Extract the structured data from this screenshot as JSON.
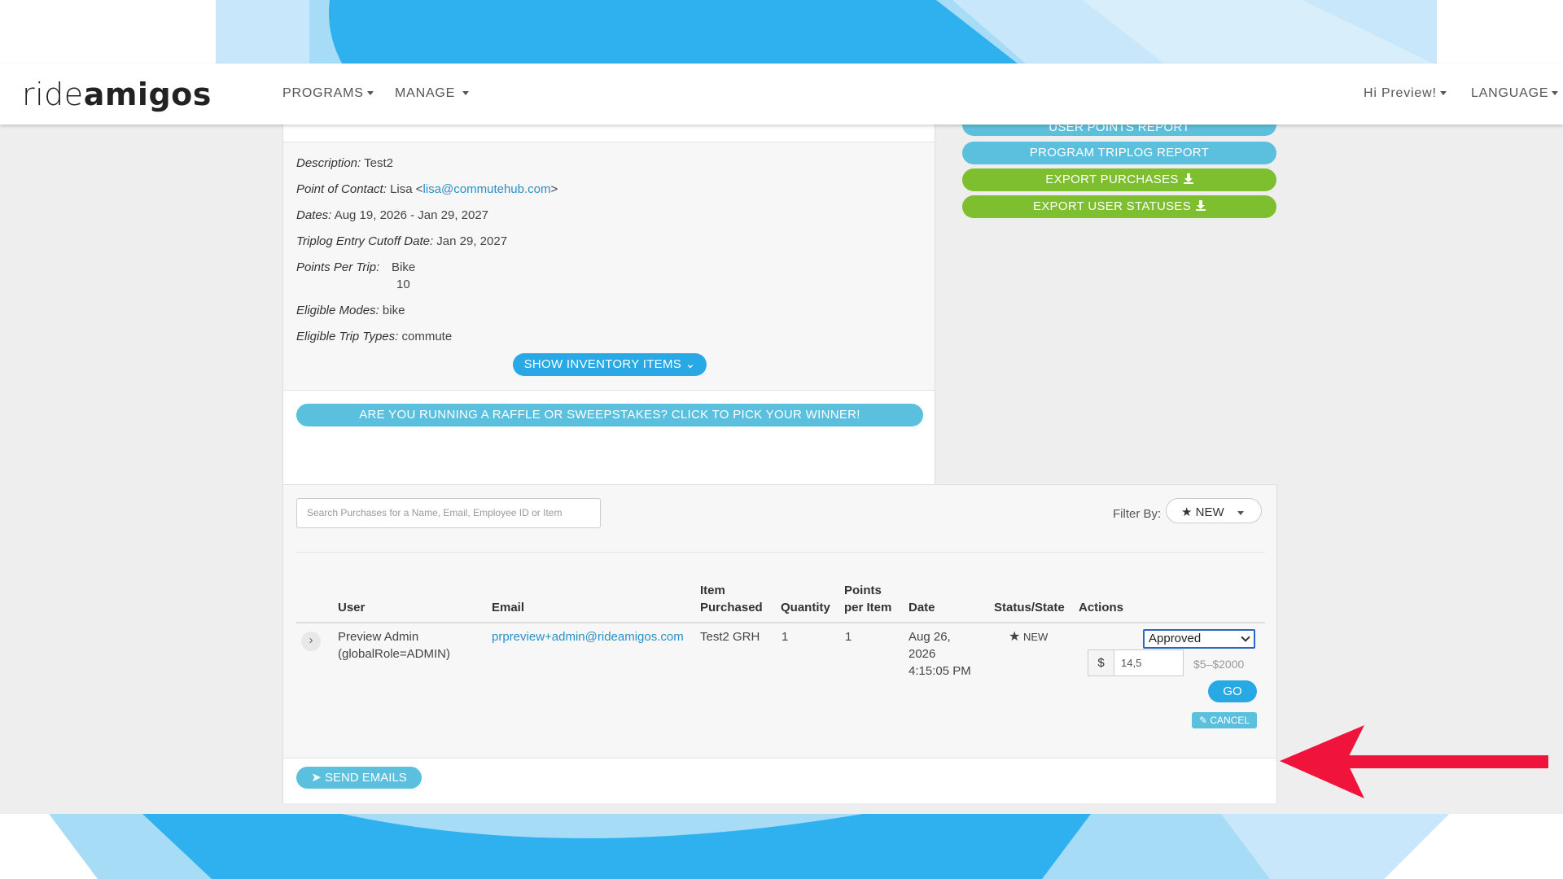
{
  "header": {
    "logo_light": "ride",
    "logo_bold": "amigos",
    "nav_programs": "PROGRAMS",
    "nav_manage": "MANAGE",
    "greeting": "Hi Preview!",
    "language": "LANGUAGE"
  },
  "sidebar_actions": {
    "user_points_report": "USER POINTS REPORT",
    "program_triplog_report": "PROGRAM TRIPLOG REPORT",
    "export_purchases": "EXPORT PURCHASES",
    "export_user_statuses": "EXPORT USER STATUSES"
  },
  "program": {
    "description_label": "Description:",
    "description": "Test2",
    "contact_label": "Point of Contact:",
    "contact_name": "Lisa <",
    "contact_email": "lisa@commutehub.com",
    "contact_close": ">",
    "dates_label": "Dates:",
    "dates": "Aug 19, 2026 - Jan 29, 2027",
    "cutoff_label": "Triplog Entry Cutoff Date:",
    "cutoff": "Jan 29, 2027",
    "points_label": "Points Per Trip:",
    "points_mode": "Bike",
    "points_value": "10",
    "modes_label": "Eligible Modes:",
    "modes": "bike",
    "trip_types_label": "Eligible Trip Types:",
    "trip_types": "commute",
    "show_inventory": "SHOW INVENTORY ITEMS",
    "raffle": "ARE YOU RUNNING A RAFFLE OR SWEEPSTAKES? CLICK TO PICK YOUR WINNER!"
  },
  "purchases": {
    "search_placeholder": "Search Purchases for a Name, Email, Employee ID or Item",
    "filter_label": "Filter By:",
    "filter_value": "NEW",
    "columns": {
      "user": "User",
      "email": "Email",
      "item_1": "Item",
      "item_2": "Purchased",
      "quantity": "Quantity",
      "points_1": "Points",
      "points_2": "per Item",
      "date": "Date",
      "status": "Status/State",
      "actions": "Actions"
    },
    "row": {
      "user_1": "Preview Admin",
      "user_2": "(globalRole=ADMIN)",
      "email": "prpreview+admin@rideamigos.com",
      "item": "Test2 GRH",
      "quantity": "1",
      "points": "1",
      "date_1": "Aug 26,",
      "date_2": "2026",
      "date_3": "4:15:05 PM",
      "status": "NEW",
      "select_value": "Approved",
      "currency": "$",
      "amount": "14,5",
      "range": "$5–$2000",
      "go": "GO",
      "cancel": "CANCEL"
    },
    "send_emails": "SEND EMAILS"
  },
  "colors": {
    "accent_blue": "#5bc0de",
    "strong_blue": "#29a8e6",
    "green": "#7dbf2e",
    "arrow_red": "#f0143c"
  }
}
